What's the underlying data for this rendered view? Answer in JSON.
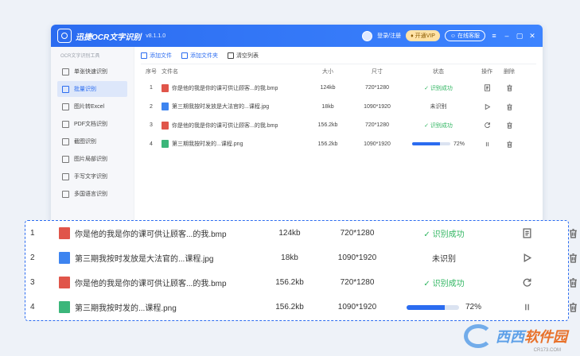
{
  "titlebar": {
    "title": "迅捷OCR文字识别",
    "version": "v8.1.1.0",
    "login": "登录/注册",
    "vip": "开通VIP",
    "service": "在线客服"
  },
  "sidebar": {
    "heading": "OCR文字识别工具",
    "items": [
      {
        "label": "单张快速识别",
        "icon": "image-icon",
        "active": false
      },
      {
        "label": "批量识别",
        "icon": "batch-icon",
        "active": true
      },
      {
        "label": "图片转Excel",
        "icon": "excel-icon",
        "active": false
      },
      {
        "label": "PDF文档识别",
        "icon": "pdf-icon",
        "active": false
      },
      {
        "label": "截图识别",
        "icon": "crop-icon",
        "active": false
      },
      {
        "label": "图片局部识别",
        "icon": "partial-icon",
        "active": false
      },
      {
        "label": "手写文字识别",
        "icon": "pen-icon",
        "active": false
      },
      {
        "label": "多国语言识别",
        "icon": "globe-icon",
        "active": false
      }
    ]
  },
  "toolbar": {
    "add_file": "添加文件",
    "add_folder": "添加文件夹",
    "clear": "清空列表"
  },
  "table": {
    "headers": {
      "no": "序号",
      "name": "文件名",
      "size": "大小",
      "dims": "尺寸",
      "status": "状态",
      "op": "操作",
      "del": "删除"
    },
    "rows": [
      {
        "no": "1",
        "type": "BMP",
        "color": "#e0554a",
        "name": "你是他的我是你的课可供让顾客...的我.bmp",
        "size": "124kb",
        "dims": "720*1280",
        "status": "识别成功",
        "state": "done",
        "op": "doc-icon"
      },
      {
        "no": "2",
        "type": "JPG",
        "color": "#3d84f0",
        "name": "第三期我按时发放是大法官的...课程.jpg",
        "size": "18kb",
        "dims": "1090*1920",
        "status": "未识别",
        "state": "pending",
        "op": "play-icon"
      },
      {
        "no": "3",
        "type": "BMP",
        "color": "#e0554a",
        "name": "你是他的我是你的课可供让顾客...的我.bmp",
        "size": "156.2kb",
        "dims": "720*1280",
        "status": "识别成功",
        "state": "done",
        "op": "refresh-icon"
      },
      {
        "no": "4",
        "type": "PNG",
        "color": "#3bb67a",
        "name": "第三期我按时发的...课程.png",
        "size": "156.2kb",
        "dims": "1090*1920",
        "status": "72%",
        "state": "progress",
        "progress": 0.72,
        "op": "pause-icon"
      }
    ]
  },
  "watermark": {
    "brand_a": "西西",
    "brand_b": "软件园",
    "sub": "CR173.COM"
  }
}
